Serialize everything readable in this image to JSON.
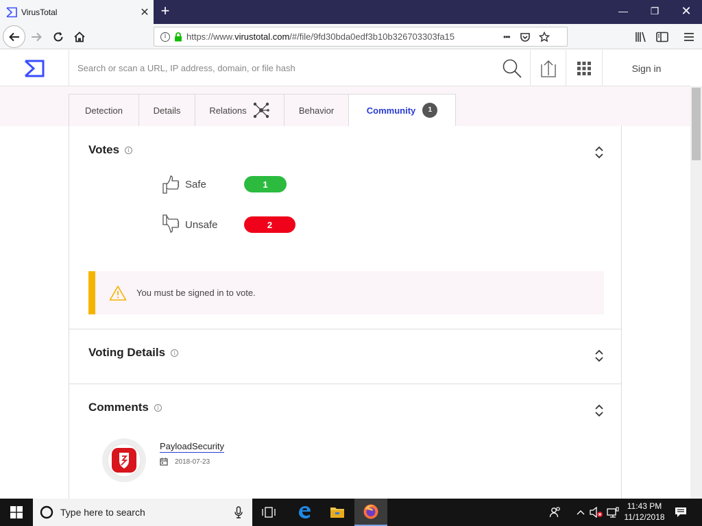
{
  "browser": {
    "tab_title": "VirusTotal",
    "url_prefix": "https://www.",
    "url_domain": "virustotal.com",
    "url_rest": "/#/file/9fd30bda0edf3b10b326703303fa15",
    "more_icon": "•••"
  },
  "header": {
    "search_placeholder": "Search or scan a URL, IP address, domain, or file hash",
    "signin_label": "Sign in"
  },
  "tabs": [
    {
      "label": "Detection"
    },
    {
      "label": "Details"
    },
    {
      "label": "Relations"
    },
    {
      "label": "Behavior"
    },
    {
      "label": "Community",
      "badge": "1"
    }
  ],
  "votes": {
    "title": "Votes",
    "safe_label": "Safe",
    "safe_count": "1",
    "unsafe_label": "Unsafe",
    "unsafe_count": "2",
    "warning": "You must be signed in to vote.",
    "colors": {
      "safe": "#2cbb3f",
      "unsafe": "#f0021a",
      "warning": "#f5b400"
    }
  },
  "voting_details": {
    "title": "Voting Details"
  },
  "comments": {
    "title": "Comments",
    "items": [
      {
        "user": "PayloadSecurity",
        "date": "2018-07-23"
      }
    ]
  },
  "taskbar": {
    "search_placeholder": "Type here to search",
    "time": "11:43 PM",
    "date": "11/12/2018"
  },
  "accent": "#2a3bd1"
}
